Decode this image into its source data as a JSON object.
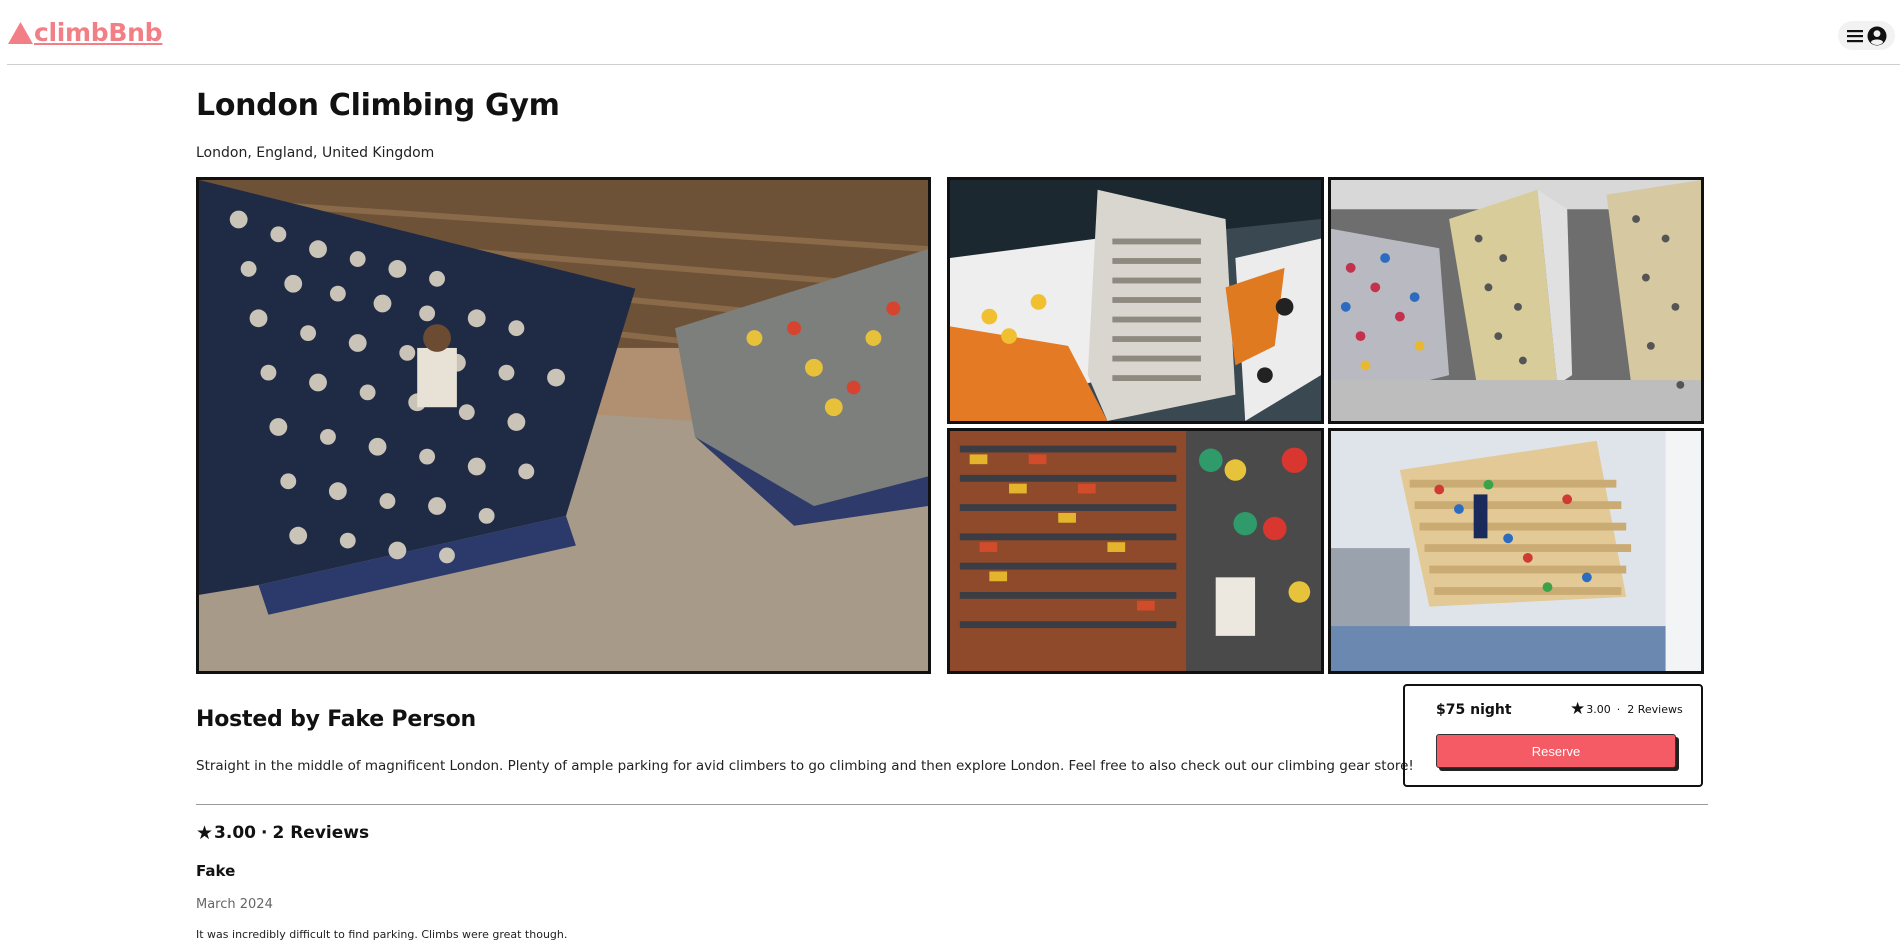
{
  "brand": {
    "name": "climbBnb",
    "logo_icon": "mountain-icon",
    "accent_color": "#f27f86"
  },
  "header": {
    "menu_icon": "hamburger-icon",
    "profile_icon": "user-circle-icon"
  },
  "spot": {
    "name": "London Climbing Gym",
    "location": "London, England, United Kingdom",
    "host": "Hosted by Fake Person",
    "description": "Straight in the middle of magnificent London. Plenty of ample parking for avid climbers to go climbing and then explore London. Feel free to also check out our climbing gear store!"
  },
  "gallery": {
    "images": [
      "bouldering-wall-photo",
      "climbing-wall-photo",
      "climbing-wall-photo",
      "gear-store-photo",
      "climbing-wall-photo"
    ]
  },
  "booking": {
    "price": "$75 night",
    "rating": "3.00",
    "separator": "·",
    "review_count": "2 Reviews",
    "reserve_label": "Reserve",
    "button_color": "#f45b65"
  },
  "reviews": {
    "rating": "3.00",
    "separator": "·",
    "count_label": "2 Reviews",
    "items": [
      {
        "author": "Fake",
        "date": "March 2024",
        "text": "It was incredibly difficult to find parking. Climbs were great though."
      }
    ]
  }
}
